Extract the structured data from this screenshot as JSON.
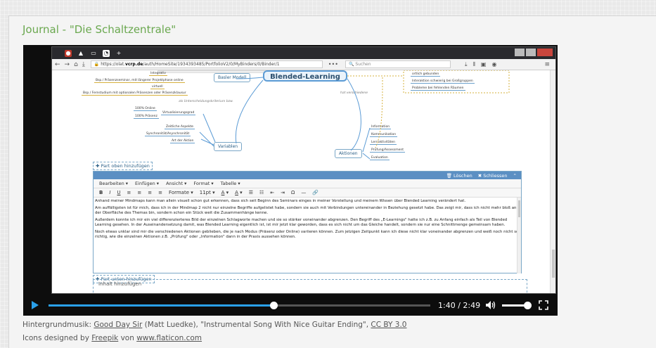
{
  "journal": {
    "title": "Journal - \"Die Schaltzentrale\""
  },
  "browser": {
    "url_prefix": "https://olat.",
    "url_host": "vcrp.de",
    "url_rest": "/auth/HomeSite/1934393485/PortfolioV2/0/MyBinders/0/Binder/1",
    "search_placeholder": "Suchen",
    "dots": "•••"
  },
  "mindmap": {
    "center": "Blended-Learning",
    "nodes": {
      "basic_model": "Basler Modell",
      "variables": "Variablen",
      "actions": "Aktionen"
    },
    "left_leaves": [
      "Integrativ",
      "Bsp./ Präsenzseminar, mit längerer Projektphase online",
      "virtuell",
      "Bsp./ Fernstudium mit optionalen Präsenzen oder Präsenzklausur",
      "Virtualisierungsgrad",
      "100% Online",
      "100% Präsenz",
      "Zeitliche Aspekte",
      "Synchronität/Asynchronität",
      "Art der Aktion"
    ],
    "right_top_leaves": [
      "ortlich gebunden",
      "Interaktion schwierig bei Großgruppen",
      "Probleme bei fehlenden Räumen"
    ],
    "right_leaves": [
      "Information",
      "Kommunikation",
      "Lernaktivitäten",
      "Prüfung/Assessment",
      "Evaluation"
    ],
    "italic_labels": [
      "als Unterscheidungskriterium bzw.",
      "hat verschiedene"
    ]
  },
  "editor": {
    "part_top": "Part oben hinzufügen",
    "delete": "Löschen",
    "close": "Schliessen",
    "menu": [
      "Bearbeiten ▾",
      "Einfügen ▾",
      "Ansicht ▾",
      "Format ▾",
      "Tabelle ▾"
    ],
    "formats": "Formate ▾",
    "font_size": "11pt ▾",
    "paragraphs": [
      "Anhand meiner Mindmaps kann man allein visuell schon gut erkennen, dass sich seit Beginn des Seminars einges in meiner Vorstellung und meinem Wissen über Blended Learning verändert hat.",
      "Am auffälligsten ist für mich, dass ich in der Mindmap 2 nicht nur einzelne Begriffe aufgelistet habe, sondern sie auch mit Verbindungen untereinander in Beziehung gesetzt habe. Das zeigt mir, dass ich nicht mehr bloß an der Oberfläche des Themas bin, sondern schon ein Stück weit die Zusammenhänge kenne.",
      "Außerdem konnte ich mir ein viel differenzierteres Bild der einzelnen Schlagworte machen und sie so stärker voneinander abgrenzen. Den Begriff des „E-Learnings\" hatte ich z.B. zu Anfang einfach als Teil von Blended Learning gesehen. In der Auseinandersetzung damit, was Blended Learning eigentlich ist, ist mir jetzt klar geworden, dass es sich nicht um das Gleiche handelt, sondern sie nur eine Schnittmenge gemeinsam haben.",
      "Noch etwas unklar sind mir die verschiedenen Aktionen geblieben, die je nach Modus (Präsenz oder Online) variieren können. Zum jetzigen Zeitpunkt kann ich diese nicht klar voneinander abgrenzen und weiß noch nicht so richtig, wie die einzelnen Aktionen z.B. „Prüfung\" oder „Information\" dann in der Praxis aussehen können."
    ],
    "part_bottom": "Part unten hinzufügen",
    "content_add": "Inhalt hinzufügen"
  },
  "player": {
    "time": "1:40 / 2:49",
    "progress": 0.59,
    "volume": 0.85
  },
  "footer": {
    "music_prefix": "Hintergrundmusik: ",
    "song": "Good Day Sir",
    "music_mid": " (Matt Luedke), \"Instrumental Song With Nice Guitar Ending\", ",
    "license": "CC BY 3.0",
    "icons_prefix": "Icons designed by ",
    "freepik": "Freepik",
    "icons_mid": " von ",
    "flaticon": "www.flaticon.com"
  },
  "colors": {
    "accent": "#6aa84f",
    "progress": "#2aa0ea",
    "editor_header": "#5b8fc3"
  }
}
